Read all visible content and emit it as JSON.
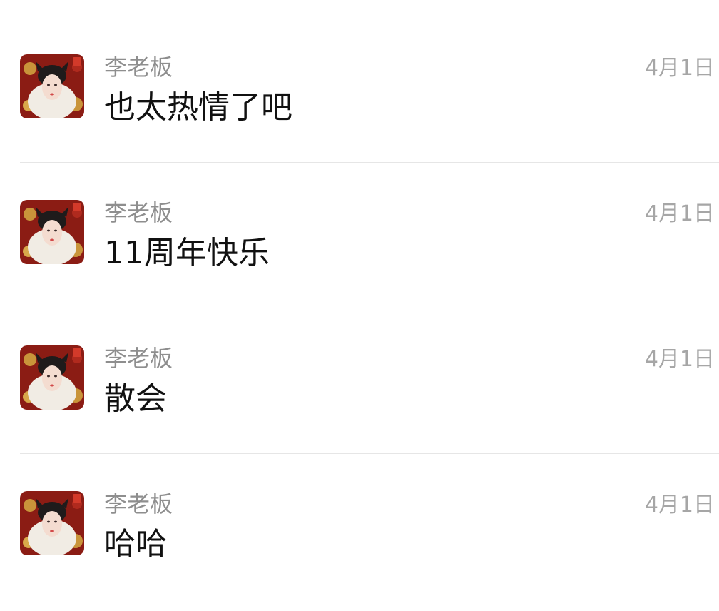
{
  "chat_list": {
    "items": [
      {
        "sender": "李老板",
        "message": "也太热情了吧",
        "date": "4月1日",
        "avatar_icon": "portrait-avatar-icon"
      },
      {
        "sender": "李老板",
        "message": "11周年快乐",
        "date": "4月1日",
        "avatar_icon": "portrait-avatar-icon"
      },
      {
        "sender": "李老板",
        "message": "散会",
        "date": "4月1日",
        "avatar_icon": "portrait-avatar-icon"
      },
      {
        "sender": "李老板",
        "message": "哈哈",
        "date": "4月1日",
        "avatar_icon": "portrait-avatar-icon"
      }
    ]
  },
  "colors": {
    "sender": "#8e8e8e",
    "message": "#111111",
    "date": "#a6a6a6",
    "divider": "#e6e6e6",
    "avatar_frame": "#8b1c14",
    "avatar_gold": "#c9943a"
  }
}
